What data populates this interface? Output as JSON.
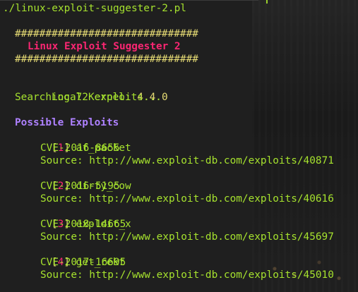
{
  "terminal": {
    "command_prompt": "./linux-exploit-suggester-2.pl",
    "banner_border": "##############################",
    "banner_title": "Linux Exploit Suggester 2",
    "local_kernel_label": "Local Kernel:",
    "local_kernel_value": "4.4.0",
    "searching_text": "Searching 72 exploits...",
    "possible_exploits_heading": "Possible Exploits",
    "exploits": [
      {
        "index_open": "[",
        "index": "1",
        "index_close": "]",
        "name": "af_packet",
        "cve": "CVE-2016-8655",
        "source": "Source: http://www.exploit-db.com/exploits/40871"
      },
      {
        "index_open": "[",
        "index": "2",
        "index_close": "]",
        "name": "dirty_cow",
        "cve": "CVE-2016-5195",
        "source": "Source: http://www.exploit-db.com/exploits/40616"
      },
      {
        "index_open": "[",
        "index": "3",
        "index_close": "]",
        "name": "exploit_x",
        "cve": "CVE-2018-14665",
        "source": "Source: http://www.exploit-db.com/exploits/45697"
      },
      {
        "index_open": "[",
        "index": "4",
        "index_close": "]",
        "name": "get_rekt",
        "cve": "CVE-2017-16695",
        "source": "Source: http://www.exploit-db.com/exploits/45010"
      }
    ]
  },
  "colors": {
    "terminal_bg": "#1f1f1f",
    "command_green": "#a6e22e",
    "banner_yellow": "#e6db74",
    "title_pink": "#f92672",
    "heading_purple": "#ae81ff"
  }
}
